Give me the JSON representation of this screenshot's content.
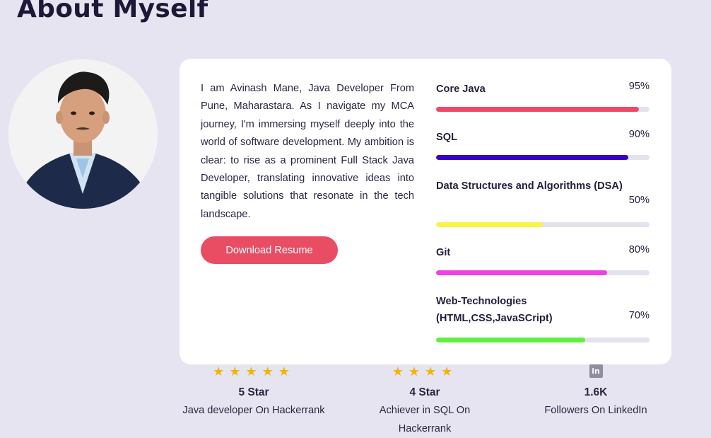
{
  "section_title": "About Myself",
  "bio": "I am Avinash Mane, Java Developer From Pune, Maharastara. As I navigate my MCA journey, I'm immersing myself deeply into the world of software development. My ambition is clear: to rise as a prominent Full Stack Java Developer, translating innovative ideas into tangible solutions that resonate in the tech landscape.",
  "resume_button": "Download Resume",
  "skills": [
    {
      "name": "Core Java",
      "percent_label": "95%",
      "level": 95,
      "color": "#ee4a67"
    },
    {
      "name": "SQL",
      "percent_label": "90%",
      "level": 90,
      "color": "#3a00c4"
    },
    {
      "name": "Data Structures and Algorithms (DSA)",
      "percent_label": "50%",
      "level": 50,
      "color": "#f7f545"
    },
    {
      "name": "Git",
      "percent_label": "80%",
      "level": 80,
      "color": "#ef40e6"
    },
    {
      "name": "Web-Technologies (HTML,CSS,JavaSCript)",
      "percent_label": "70%",
      "level": 70,
      "color": "#5ff03e"
    }
  ],
  "stats": [
    {
      "icon": "star-icon",
      "stars": "★★★★★",
      "value": "5 Star",
      "label": "Java developer On Hackerrank"
    },
    {
      "icon": "star-icon",
      "stars": "★★★★",
      "value": "4 Star",
      "label": "Achiever in SQL On Hackerrank"
    },
    {
      "icon": "linkedin-icon",
      "icon_text": "in",
      "value": "1.6K",
      "label": "Followers On LinkedIn"
    }
  ]
}
